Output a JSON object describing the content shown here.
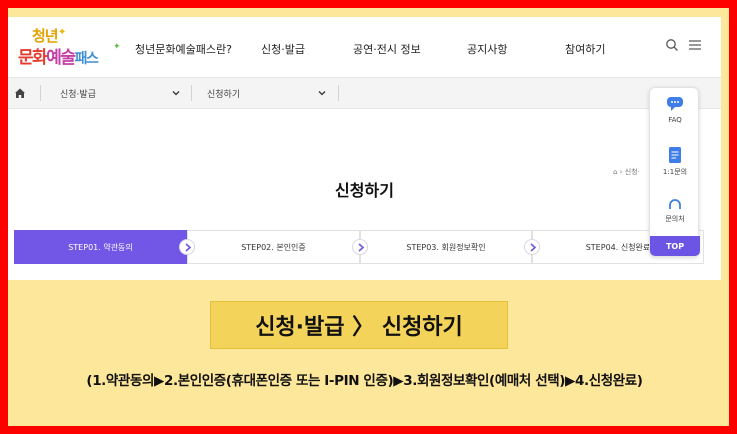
{
  "logo": {
    "line1": "청년",
    "line2a": "문화",
    "line2b": "예술",
    "line2c": "패스"
  },
  "nav": {
    "items": [
      {
        "label": "청년문화예술패스란?"
      },
      {
        "label": "신청·발급"
      },
      {
        "label": "공연·전시 정보"
      },
      {
        "label": "공지사항"
      },
      {
        "label": "참여하기"
      }
    ],
    "icons": [
      "search-icon",
      "menu-icon"
    ]
  },
  "breadcrumb": {
    "level1": "신청·발급",
    "level2": "신청하기",
    "mini": "신청·"
  },
  "page": {
    "title": "신청하기"
  },
  "steps": [
    {
      "label": "STEP01. 약관동의",
      "active": true
    },
    {
      "label": "STEP02. 본인인증",
      "active": false
    },
    {
      "label": "STEP03. 회원정보확인",
      "active": false
    },
    {
      "label": "STEP04. 신청완료",
      "active": false
    }
  ],
  "float_panel": {
    "faq": "FAQ",
    "inquiry": "1:1문의",
    "chat": "문의처",
    "top": "TOP"
  },
  "annotation": {
    "heading": "신청·발급 〉 신청하기",
    "description": "(1.약관동의▶2.본인인증(휴대폰인증 또는 I-PIN 인증)▶3.회원정보확인(예매처 선택)▶4.신청완료)"
  },
  "colors": {
    "frame_border": "#ff0000",
    "background": "#fde79a",
    "accent": "#7257e6",
    "caption_box": "#f4d35a"
  }
}
